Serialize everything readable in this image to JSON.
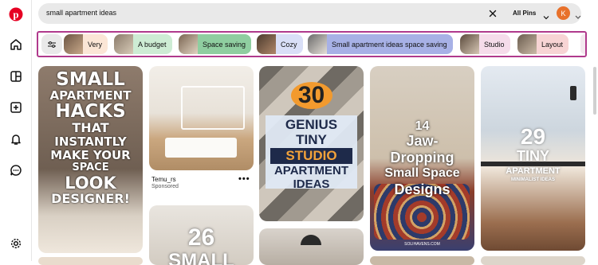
{
  "search": {
    "query": "small apartment ideas",
    "scope_label": "All Pins"
  },
  "account": {
    "avatar_initial": "K"
  },
  "chips": [
    {
      "label": "Very"
    },
    {
      "label": "A budget"
    },
    {
      "label": "Space saving"
    },
    {
      "label": "Cozy"
    },
    {
      "label": "Small apartment ideas space saving"
    },
    {
      "label": "Studio"
    },
    {
      "label": "Layout"
    }
  ],
  "pins": {
    "hacks": {
      "l1": "SMALL",
      "l2": "APARTMENT",
      "l3": "HACKS",
      "l4": "THAT",
      "l5": "INSTANTLY",
      "l6": "MAKE YOUR",
      "l7": "SPACE",
      "l8": "LOOK",
      "l9": "DESIGNER!"
    },
    "kitchen": {
      "author": "Temu_rs",
      "sponsored": "Sponsored"
    },
    "studio": {
      "n": "30",
      "l1": "GENIUS",
      "l2": "TINY",
      "l3": "STUDIO",
      "l4": "APARTMENT",
      "l5": "IDEAS"
    },
    "jaw": {
      "l1": "14",
      "l2": "Jaw-",
      "l3": "Dropping",
      "l4": "Small Space",
      "l5": "Designs",
      "site": "SOLIHAVENS.COM"
    },
    "tiny": {
      "n": "29",
      "l1": "TINY",
      "l2": "APARTMENT",
      "l3": "MINIMALIST IDEAS"
    },
    "small26": {
      "n": "26",
      "l1": "SMALL"
    }
  },
  "colors": {
    "brand": "#e60023",
    "chipbar_border": "#b03a8c",
    "avatar": "#e8712b"
  }
}
